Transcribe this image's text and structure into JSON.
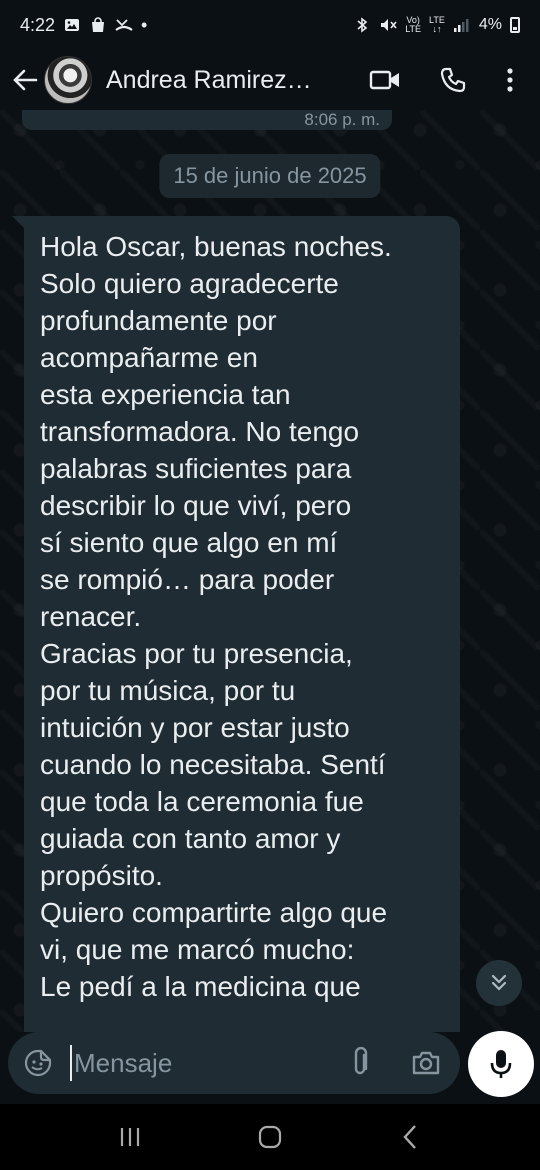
{
  "status_bar": {
    "time": "4:22",
    "dot": "•",
    "network_top": "Vo)",
    "network_bottom": "LTE",
    "lte_top": "LTE",
    "lte_bottom": "↓↑",
    "battery": "4%",
    "left_icons": [
      "gallery-icon",
      "shopping-bag-icon",
      "missed-call-icon"
    ],
    "right_icons": [
      "bluetooth-icon",
      "mute-icon",
      "signal-icon",
      "battery-icon"
    ]
  },
  "header": {
    "contact_name": "Andrea Ramirez…",
    "icons": [
      "back-arrow-icon",
      "video-call-icon",
      "phone-icon",
      "more-options-icon"
    ]
  },
  "chat": {
    "previous_message_time": "8:06 p. m.",
    "date_divider": "15 de junio de 2025",
    "message_text": "Hola Oscar, buenas noches.\nSolo quiero agradecerte\nprofundamente por\nacompañarme en\nesta experiencia tan\ntransformadora. No tengo\npalabras suficientes para\ndescribir lo que viví, pero\nsí siento que algo en mí\nse rompió… para poder\nrenacer.\nGracias por tu presencia,\npor tu música, por tu\nintuición y por estar justo\ncuando lo necesitaba. Sentí\nque toda la ceremonia fue\nguiada con tanto amor y\npropósito.\nQuiero compartirte algo que\nvi, que me marcó mucho:\nLe pedí a la medicina que"
  },
  "input": {
    "placeholder": "Mensaje",
    "value": ""
  },
  "colors": {
    "background": "#0b1014",
    "bubble": "#1f2c33",
    "text": "#e9edef",
    "muted": "#8696a0",
    "mic_button": "#ffffff"
  }
}
